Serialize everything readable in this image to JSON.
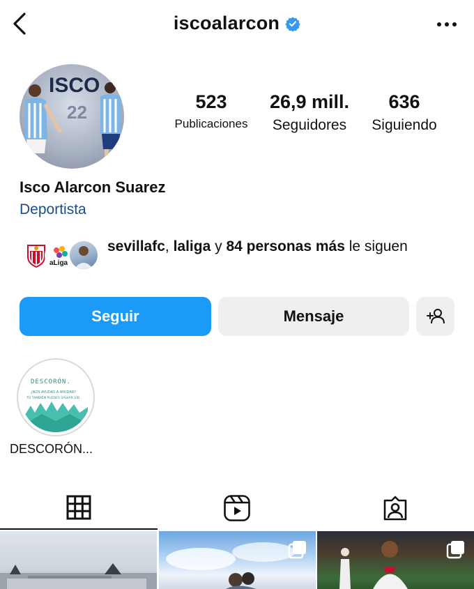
{
  "header": {
    "username": "iscoalarcon",
    "back_icon": "chevron-left-icon",
    "verified_icon": "verified-badge-icon",
    "more_icon": "more-horizontal-icon"
  },
  "profile": {
    "avatar_text": "ISCO",
    "avatar_number": "22",
    "full_name": "Isco Alarcon Suarez",
    "category": "Deportista",
    "stats": [
      {
        "value": "523",
        "label": "Publicaciones"
      },
      {
        "value": "26,9 mill.",
        "label": "Seguidores"
      },
      {
        "value": "636",
        "label": "Siguiendo"
      }
    ]
  },
  "followed_by": {
    "account1": "sevillafc",
    "sep1": ", ",
    "account2": "laliga",
    "mid": " y ",
    "others": "84 personas más",
    "tail": " le siguen"
  },
  "actions": {
    "follow": "Seguir",
    "message": "Mensaje",
    "add_user_icon": "add-user-icon"
  },
  "highlights": [
    {
      "label": "DESCORÓN...",
      "cover_title": "DESCORÓN.",
      "cover_line1": "¿NOS AYUDAS A AYUDAR?",
      "cover_line2": "TÚ TAMBIÉN PUEDES SALVAR VID"
    }
  ],
  "tabs": [
    {
      "icon": "grid-icon",
      "selected": true
    },
    {
      "icon": "reels-icon",
      "selected": false
    },
    {
      "icon": "tagged-icon",
      "selected": false
    }
  ],
  "colors": {
    "primary_button": "#1b9af7",
    "secondary_button": "#efefef",
    "category_text": "#1b4d8c",
    "verified": "#3897f0"
  }
}
